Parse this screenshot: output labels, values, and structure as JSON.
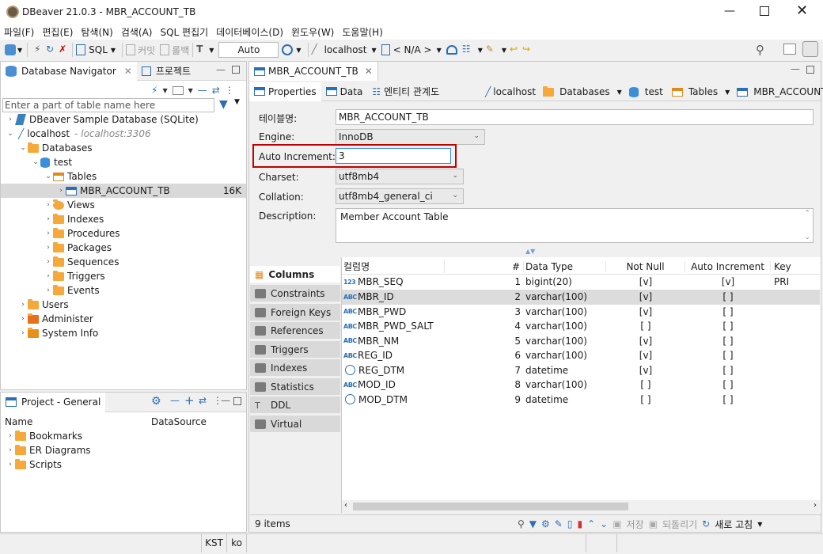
{
  "window": {
    "title": "DBeaver 21.0.3 - MBR_ACCOUNT_TB"
  },
  "menu": [
    "파일(F)",
    "편집(E)",
    "탐색(N)",
    "검색(A)",
    "SQL 편집기",
    "데이터베이스(D)",
    "윈도우(W)",
    "도움말(H)"
  ],
  "toolbar": {
    "sql": "SQL",
    "commit": "커밋",
    "rollback": "롤백",
    "auto": "Auto",
    "connection": "localhost",
    "schema": "< N/A >"
  },
  "navigator": {
    "tab_title": "Database Navigator",
    "project_tab": "프로젝트",
    "filter_placeholder": "Enter a part of table name here",
    "tree": {
      "sample": "DBeaver Sample Database (SQLite)",
      "localhost": "localhost",
      "localhost_host": "- localhost:3306",
      "databases": "Databases",
      "test": "test",
      "tables": "Tables",
      "table": "MBR_ACCOUNT_TB",
      "table_size": "16K",
      "views": "Views",
      "indexes": "Indexes",
      "procedures": "Procedures",
      "packages": "Packages",
      "sequences": "Sequences",
      "triggers": "Triggers",
      "events": "Events",
      "users": "Users",
      "administer": "Administer",
      "system_info": "System Info"
    }
  },
  "project": {
    "title": "Project - General",
    "col_name": "Name",
    "col_ds": "DataSource",
    "items": [
      "Bookmarks",
      "ER Diagrams",
      "Scripts"
    ]
  },
  "editor": {
    "tab": "MBR_ACCOUNT_TB",
    "subtabs": {
      "properties": "Properties",
      "data": "Data",
      "er": "엔티티 관계도"
    },
    "breadcrumb": {
      "conn": "localhost",
      "databases": "Databases",
      "db": "test",
      "tables": "Tables",
      "table": "MBR_ACCOUNT_TB"
    },
    "props": {
      "table_name_label": "테이블명:",
      "table_name": "MBR_ACCOUNT_TB",
      "engine_label": "Engine:",
      "engine": "InnoDB",
      "ai_label": "Auto Increment:",
      "ai": "3",
      "charset_label": "Charset:",
      "charset": "utf8mb4",
      "collation_label": "Collation:",
      "collation": "utf8mb4_general_ci",
      "desc_label": "Description:",
      "desc": "Member Account Table"
    },
    "sidetabs": [
      "Columns",
      "Constraints",
      "Foreign Keys",
      "References",
      "Triggers",
      "Indexes",
      "Statistics",
      "DDL",
      "Virtual"
    ],
    "columns": {
      "headers": {
        "name": "컬럼명",
        "num": "#",
        "type": "Data Type",
        "nn": "Not Null",
        "ai": "Auto Increment",
        "key": "Key"
      },
      "rows": [
        {
          "icon": "123",
          "name": "MBR_SEQ",
          "num": "1",
          "type": "bigint(20)",
          "nn": "[v]",
          "ai": "[v]",
          "key": "PRI"
        },
        {
          "icon": "ABC",
          "name": "MBR_ID",
          "num": "2",
          "type": "varchar(100)",
          "nn": "[v]",
          "ai": "[ ]",
          "key": ""
        },
        {
          "icon": "ABC",
          "name": "MBR_PWD",
          "num": "3",
          "type": "varchar(100)",
          "nn": "[v]",
          "ai": "[ ]",
          "key": ""
        },
        {
          "icon": "ABC",
          "name": "MBR_PWD_SALT",
          "num": "4",
          "type": "varchar(100)",
          "nn": "[ ]",
          "ai": "[ ]",
          "key": ""
        },
        {
          "icon": "ABC",
          "name": "MBR_NM",
          "num": "5",
          "type": "varchar(100)",
          "nn": "[v]",
          "ai": "[ ]",
          "key": ""
        },
        {
          "icon": "ABC",
          "name": "REG_ID",
          "num": "6",
          "type": "varchar(100)",
          "nn": "[v]",
          "ai": "[ ]",
          "key": ""
        },
        {
          "icon": "clock",
          "name": "REG_DTM",
          "num": "7",
          "type": "datetime",
          "nn": "[v]",
          "ai": "[ ]",
          "key": ""
        },
        {
          "icon": "ABC",
          "name": "MOD_ID",
          "num": "8",
          "type": "varchar(100)",
          "nn": "[ ]",
          "ai": "[ ]",
          "key": ""
        },
        {
          "icon": "clock",
          "name": "MOD_DTM",
          "num": "9",
          "type": "datetime",
          "nn": "[ ]",
          "ai": "[ ]",
          "key": ""
        }
      ]
    },
    "footer": {
      "count": "9 items",
      "save": "저장",
      "revert": "되돌리기",
      "refresh": "새로 고침"
    }
  },
  "status": {
    "tz": "KST",
    "lang": "ko"
  },
  "colors": {
    "highlight": "#c00000",
    "selection": "#dcdcdc",
    "accent": "#2a6fb5"
  }
}
